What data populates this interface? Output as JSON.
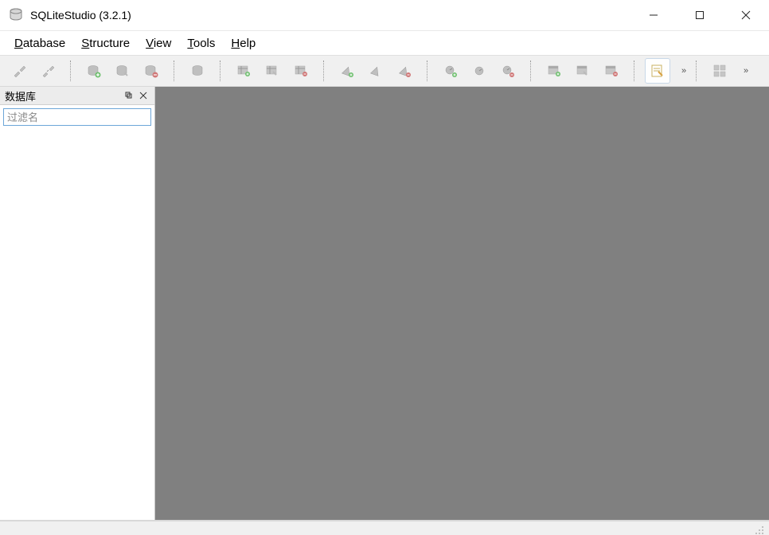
{
  "window": {
    "title": "SQLiteStudio (3.2.1)"
  },
  "menubar": {
    "items": [
      {
        "hotkey": "D",
        "rest": "atabase"
      },
      {
        "hotkey": "S",
        "rest": "tructure"
      },
      {
        "hotkey": "V",
        "rest": "iew"
      },
      {
        "hotkey": "T",
        "rest": "ools"
      },
      {
        "hotkey": "H",
        "rest": "elp"
      }
    ]
  },
  "dock": {
    "title": "数据库",
    "filter_placeholder": "过滤名"
  },
  "toolbar": {
    "overflow": "»"
  }
}
